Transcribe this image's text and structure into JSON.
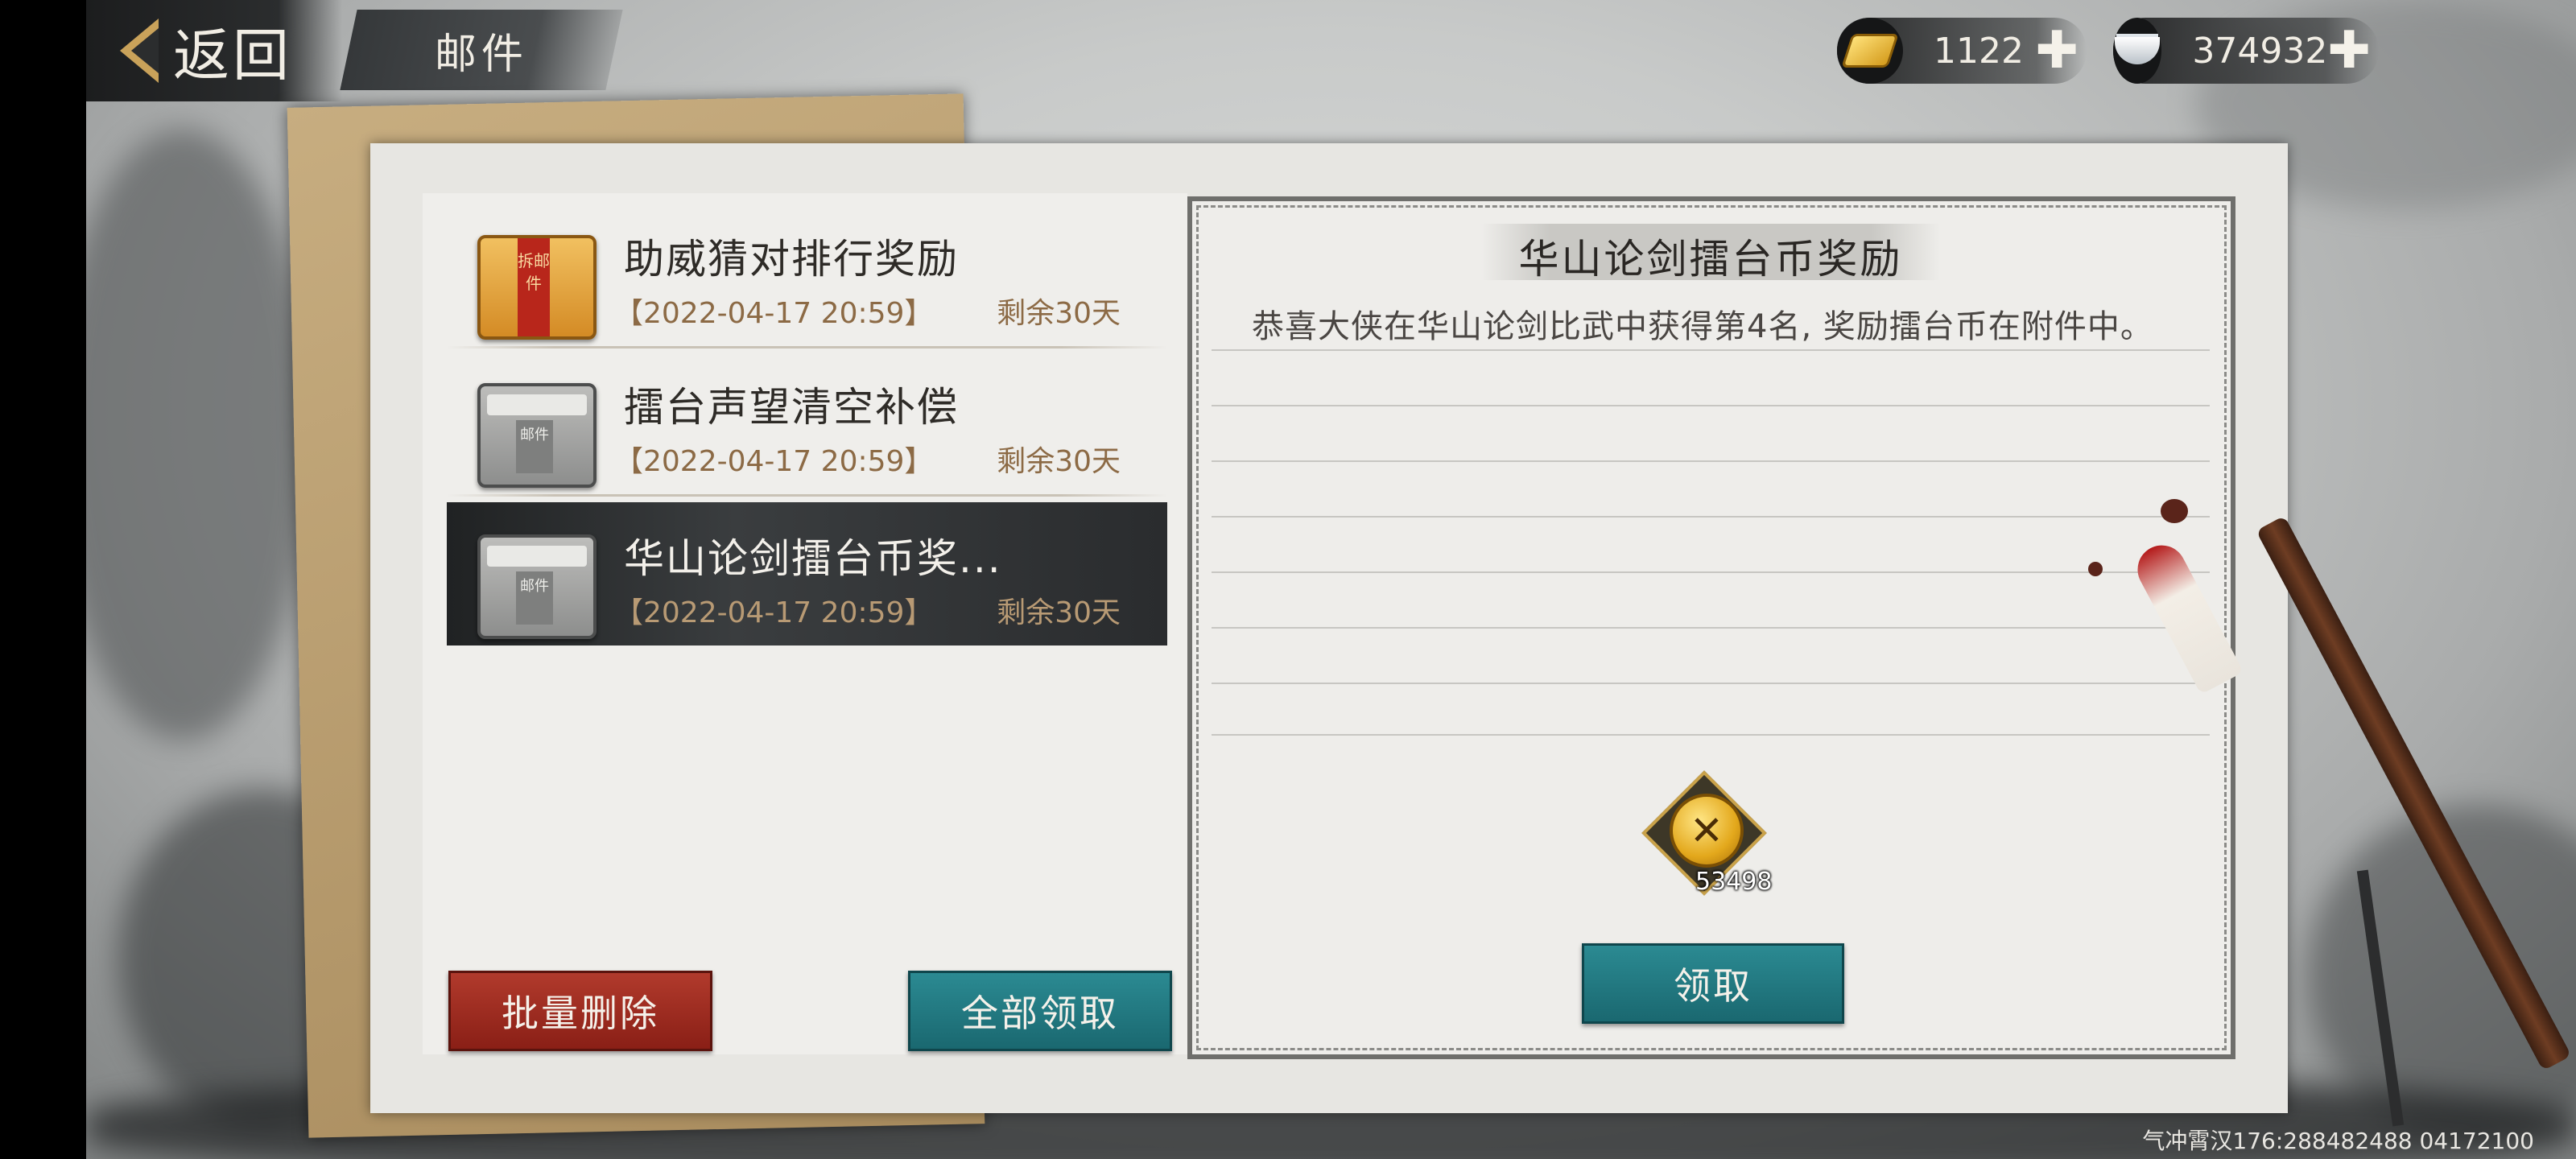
{
  "header": {
    "back_label": "返回",
    "tab_label": "邮件"
  },
  "currency": {
    "gold_value": "1122",
    "silver_value": "374932",
    "plus_symbol": "✚"
  },
  "mail_list": {
    "items": [
      {
        "title": "助威猜对排行奖励",
        "date": "【2022-04-17 20:59】",
        "remaining": "剩余30天",
        "envelope": "gold",
        "envelope_text": "拆邮件",
        "selected": false
      },
      {
        "title": "擂台声望清空补偿",
        "date": "【2022-04-17 20:59】",
        "remaining": "剩余30天",
        "envelope": "grey",
        "envelope_text": "邮件",
        "selected": false
      },
      {
        "title": "华山论剑擂台币奖...",
        "date": "【2022-04-17 20:59】",
        "remaining": "剩余30天",
        "envelope": "grey",
        "envelope_text": "邮件",
        "selected": true
      }
    ],
    "delete_label": "批量删除",
    "claim_all_label": "全部领取"
  },
  "detail": {
    "title": "华山论剑擂台币奖励",
    "body": "恭喜大侠在华山论剑比武中获得第4名, 奖励擂台币在附件中。",
    "attachment_count": "53498",
    "attachment_icon": "arena-coin-icon",
    "claim_label": "领取"
  },
  "footer": {
    "id_text": "气冲霄汉176:288482488 04172100"
  },
  "colors": {
    "accent_teal": "#1a6870",
    "accent_red": "#8a1f16",
    "date_brown": "#8c6a45"
  }
}
